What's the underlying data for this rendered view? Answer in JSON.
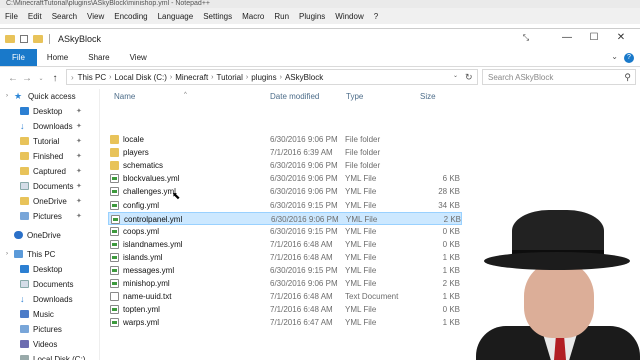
{
  "npp": {
    "title": "C:\\MinecraftTutorial\\plugins\\ASkyBlock\\minishop.yml - Notepad++",
    "menu": [
      "File",
      "Edit",
      "Search",
      "View",
      "Encoding",
      "Language",
      "Settings",
      "Macro",
      "Run",
      "Plugins",
      "Window",
      "?"
    ]
  },
  "window": {
    "title": "ASkyBlock",
    "min": "—",
    "max": "☐",
    "close": "✕"
  },
  "ribbon": {
    "tabs": [
      "File",
      "Home",
      "Share",
      "View"
    ]
  },
  "address": {
    "crumbs": [
      "This PC",
      "Local Disk (C:)",
      "Minecraft",
      "Tutorial",
      "plugins",
      "ASkyBlock"
    ]
  },
  "search": {
    "placeholder": "Search ASkyBlock"
  },
  "nav": {
    "items": [
      {
        "label": "Quick access",
        "icon": "star-icon"
      },
      {
        "label": "Desktop",
        "icon": "desktop-icon"
      },
      {
        "label": "Downloads",
        "icon": "download-icon"
      },
      {
        "label": "Tutorial",
        "icon": "folder-icon"
      },
      {
        "label": "Finished",
        "icon": "folder-icon"
      },
      {
        "label": "Captured",
        "icon": "folder-icon"
      },
      {
        "label": "Documents",
        "icon": "documents-icon"
      },
      {
        "label": "OneDrive",
        "icon": "folder-icon"
      },
      {
        "label": "Pictures",
        "icon": "pictures-icon"
      },
      {
        "label": "OneDrive",
        "icon": "cloud-icon"
      },
      {
        "label": "This PC",
        "icon": "computer-icon"
      },
      {
        "label": "Desktop",
        "icon": "desktop-icon"
      },
      {
        "label": "Documents",
        "icon": "documents-icon"
      },
      {
        "label": "Downloads",
        "icon": "download-icon"
      },
      {
        "label": "Music",
        "icon": "music-icon"
      },
      {
        "label": "Pictures",
        "icon": "pictures-icon"
      },
      {
        "label": "Videos",
        "icon": "videos-icon"
      },
      {
        "label": "Local Disk (C:)",
        "icon": "disk-icon"
      }
    ]
  },
  "columns": {
    "name": "Name",
    "date": "Date modified",
    "type": "Type",
    "size": "Size"
  },
  "files": [
    {
      "name": "locale",
      "date": "6/30/2016 9:06 PM",
      "type": "File folder",
      "size": "",
      "kind": "folder"
    },
    {
      "name": "players",
      "date": "7/1/2016 6:39 AM",
      "type": "File folder",
      "size": "",
      "kind": "folder"
    },
    {
      "name": "schematics",
      "date": "6/30/2016 9:06 PM",
      "type": "File folder",
      "size": "",
      "kind": "folder"
    },
    {
      "name": "blockvalues.yml",
      "date": "6/30/2016 9:06 PM",
      "type": "YML File",
      "size": "6 KB",
      "kind": "file"
    },
    {
      "name": "challenges.yml",
      "date": "6/30/2016 9:06 PM",
      "type": "YML File",
      "size": "28 KB",
      "kind": "file"
    },
    {
      "name": "config.yml",
      "date": "6/30/2016 9:15 PM",
      "type": "YML File",
      "size": "34 KB",
      "kind": "file"
    },
    {
      "name": "controlpanel.yml",
      "date": "6/30/2016 9:06 PM",
      "type": "YML File",
      "size": "2 KB",
      "kind": "file",
      "selected": true
    },
    {
      "name": "coops.yml",
      "date": "6/30/2016 9:15 PM",
      "type": "YML File",
      "size": "0 KB",
      "kind": "file"
    },
    {
      "name": "islandnames.yml",
      "date": "7/1/2016 6:48 AM",
      "type": "YML File",
      "size": "0 KB",
      "kind": "file"
    },
    {
      "name": "islands.yml",
      "date": "7/1/2016 6:48 AM",
      "type": "YML File",
      "size": "1 KB",
      "kind": "file"
    },
    {
      "name": "messages.yml",
      "date": "6/30/2016 9:15 PM",
      "type": "YML File",
      "size": "1 KB",
      "kind": "file"
    },
    {
      "name": "minishop.yml",
      "date": "6/30/2016 9:06 PM",
      "type": "YML File",
      "size": "2 KB",
      "kind": "file"
    },
    {
      "name": "name-uuid.txt",
      "date": "7/1/2016 6:48 AM",
      "type": "Text Document",
      "size": "1 KB",
      "kind": "txt"
    },
    {
      "name": "topten.yml",
      "date": "7/1/2016 6:48 AM",
      "type": "YML File",
      "size": "0 KB",
      "kind": "file"
    },
    {
      "name": "warps.yml",
      "date": "7/1/2016 6:47 AM",
      "type": "YML File",
      "size": "1 KB",
      "kind": "file"
    }
  ]
}
